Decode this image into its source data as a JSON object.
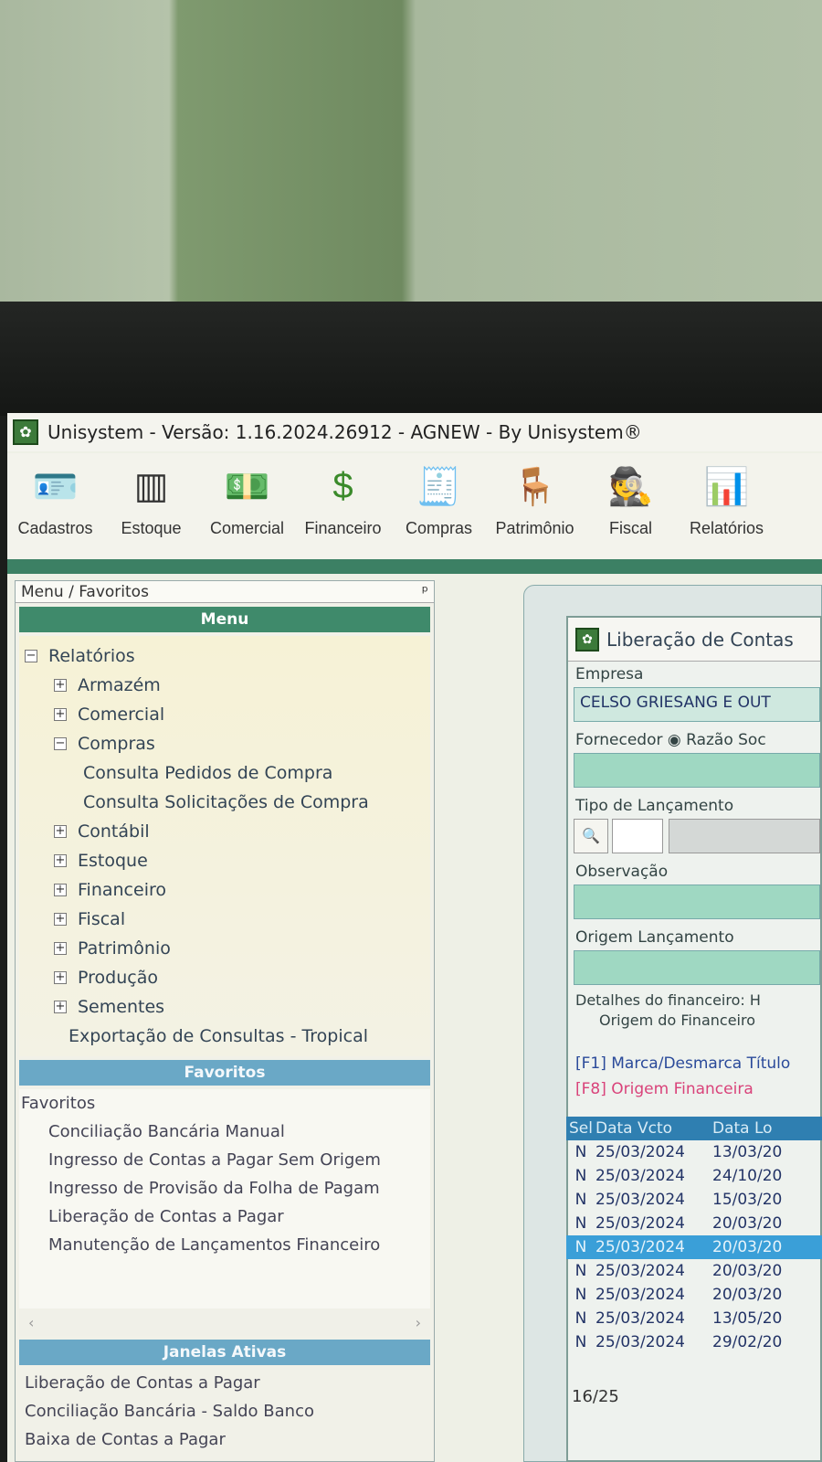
{
  "app": {
    "title": "Unisystem - Versão: 1.16.2024.26912 - AGNEW - By Unisystem®"
  },
  "toolbar": [
    "Cadastros",
    "Estoque",
    "Comercial",
    "Financeiro",
    "Compras",
    "Patrimônio",
    "Fiscal",
    "Relatórios"
  ],
  "left_panel": {
    "title": "Menu / Favoritos",
    "pin": "ᵖ",
    "menu_header": "Menu",
    "tree": [
      {
        "label": "Relatórios",
        "sign": "−",
        "indent": 0
      },
      {
        "label": "Armazém",
        "sign": "+",
        "indent": 1
      },
      {
        "label": "Comercial",
        "sign": "+",
        "indent": 1
      },
      {
        "label": "Compras",
        "sign": "−",
        "indent": 1
      },
      {
        "label": "Consulta Pedidos de Compra",
        "sign": "",
        "indent": 2
      },
      {
        "label": "Consulta Solicitações de Compra",
        "sign": "",
        "indent": 2
      },
      {
        "label": "Contábil",
        "sign": "+",
        "indent": 1
      },
      {
        "label": "Estoque",
        "sign": "+",
        "indent": 1
      },
      {
        "label": "Financeiro",
        "sign": "+",
        "indent": 1
      },
      {
        "label": "Fiscal",
        "sign": "+",
        "indent": 1
      },
      {
        "label": "Patrimônio",
        "sign": "+",
        "indent": 1
      },
      {
        "label": "Produção",
        "sign": "+",
        "indent": 1
      },
      {
        "label": "Sementes",
        "sign": "+",
        "indent": 1
      },
      {
        "label": "Exportação de Consultas - Tropical",
        "sign": "",
        "indent": 1.5
      }
    ],
    "favorites_header": "Favoritos",
    "favorites_root": "Favoritos",
    "favorites": [
      "Conciliação Bancária Manual",
      "Ingresso de Contas a Pagar Sem Origem",
      "Ingresso de Provisão da Folha de Pagam",
      "Liberação de Contas a Pagar",
      "Manutenção de Lançamentos Financeiro"
    ],
    "active_header": "Janelas Ativas",
    "active": [
      "Liberação de Contas a Pagar",
      "Conciliação Bancária - Saldo Banco",
      "Baixa de Contas a Pagar"
    ]
  },
  "dialog": {
    "title": "Liberação de Contas",
    "empresa_label": "Empresa",
    "empresa_value": "CELSO GRIESANG E OUT",
    "fornecedor_label": "Fornecedor",
    "razao_label": "Razão Soc",
    "tipo_label": "Tipo de Lançamento",
    "obs_label": "Observação",
    "origem_label": "Origem Lançamento",
    "detalhes": "Detalhes do financeiro: H",
    "origem_fin": "Origem do Financeiro",
    "f1": "[F1] Marca/Desmarca Título",
    "f8": "[F8] Origem Financeira",
    "columns": [
      "Sel",
      "Data Vcto",
      "Data Lo"
    ],
    "rows": [
      [
        "N",
        "25/03/2024",
        "13/03/20"
      ],
      [
        "N",
        "25/03/2024",
        "24/10/20"
      ],
      [
        "N",
        "25/03/2024",
        "15/03/20"
      ],
      [
        "N",
        "25/03/2024",
        "20/03/20"
      ],
      [
        "N",
        "25/03/2024",
        "20/03/20"
      ],
      [
        "N",
        "25/03/2024",
        "20/03/20"
      ],
      [
        "N",
        "25/03/2024",
        "20/03/20"
      ],
      [
        "N",
        "25/03/2024",
        "13/05/20"
      ],
      [
        "N",
        "25/03/2024",
        "29/02/20"
      ]
    ],
    "selected_row": 4,
    "count": "16/25"
  }
}
